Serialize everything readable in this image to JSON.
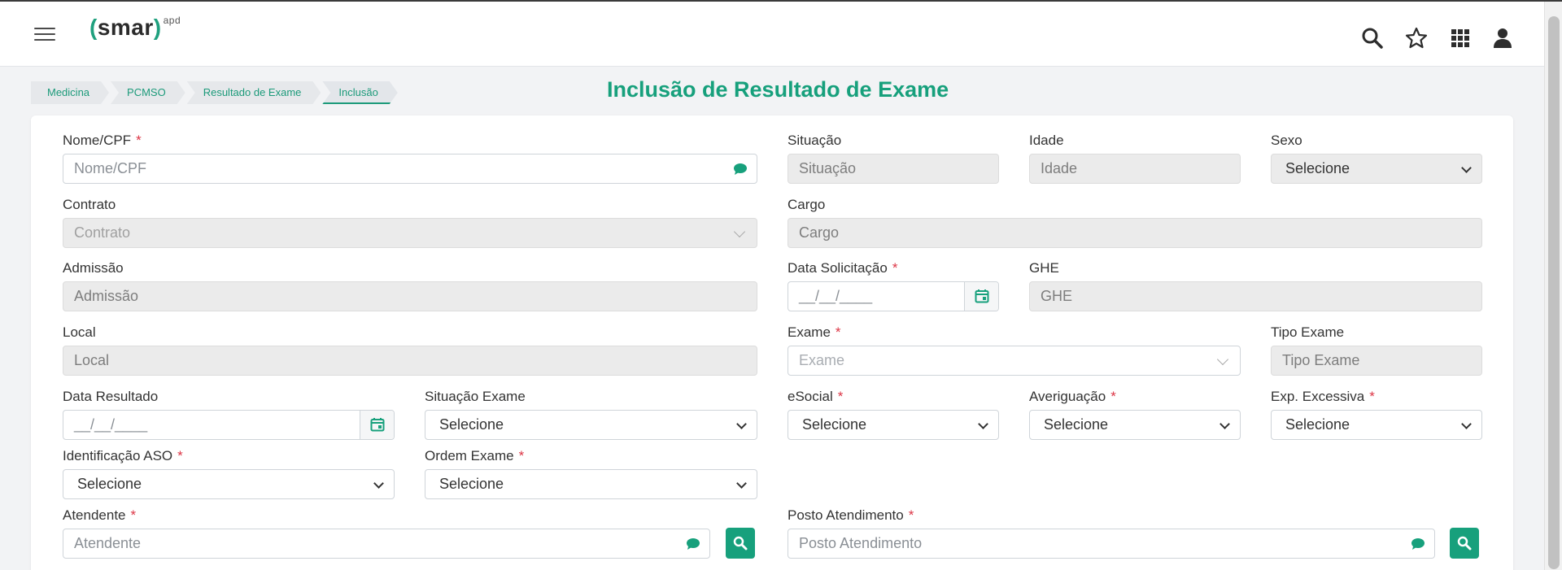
{
  "app": {
    "logo_text": "smar",
    "logo_sup": "apd"
  },
  "breadcrumbs": [
    "Medicina",
    "PCMSO",
    "Resultado de Exame",
    "Inclusão"
  ],
  "page_title": "Inclusão de Resultado de Exame",
  "required_mark": "*",
  "fields": {
    "nome_cpf": {
      "label": "Nome/CPF",
      "placeholder": "Nome/CPF"
    },
    "situacao": {
      "label": "Situação",
      "placeholder": "Situação"
    },
    "idade": {
      "label": "Idade",
      "placeholder": "Idade"
    },
    "sexo": {
      "label": "Sexo",
      "value": "Selecione"
    },
    "contrato": {
      "label": "Contrato",
      "placeholder": "Contrato"
    },
    "cargo": {
      "label": "Cargo",
      "placeholder": "Cargo"
    },
    "admissao": {
      "label": "Admissão",
      "placeholder": "Admissão"
    },
    "data_solicitacao": {
      "label": "Data Solicitação",
      "placeholder": "__/__/____"
    },
    "ghe": {
      "label": "GHE",
      "placeholder": "GHE"
    },
    "local": {
      "label": "Local",
      "placeholder": "Local"
    },
    "exame": {
      "label": "Exame",
      "placeholder": "Exame"
    },
    "tipo_exame": {
      "label": "Tipo Exame",
      "placeholder": "Tipo Exame"
    },
    "data_resultado": {
      "label": "Data Resultado",
      "placeholder": "__/__/____"
    },
    "situacao_exame": {
      "label": "Situação Exame",
      "value": "Selecione"
    },
    "esocial": {
      "label": "eSocial",
      "value": "Selecione"
    },
    "averiguacao": {
      "label": "Averiguação",
      "value": "Selecione"
    },
    "exp_excessiva": {
      "label": "Exp. Excessiva",
      "value": "Selecione"
    },
    "identificacao_aso": {
      "label": "Identificação ASO",
      "value": "Selecione"
    },
    "ordem_exame": {
      "label": "Ordem Exame",
      "value": "Selecione"
    },
    "atendente": {
      "label": "Atendente",
      "placeholder": "Atendente"
    },
    "posto_atendimento": {
      "label": "Posto Atendimento",
      "placeholder": "Posto Atendimento"
    }
  },
  "colors": {
    "accent": "#17a07c",
    "required": "#dc3545"
  },
  "icons": [
    "menu-icon",
    "search-icon",
    "star-icon",
    "apps-grid-icon",
    "user-icon",
    "chat-bubble-icon",
    "calendar-icon"
  ]
}
